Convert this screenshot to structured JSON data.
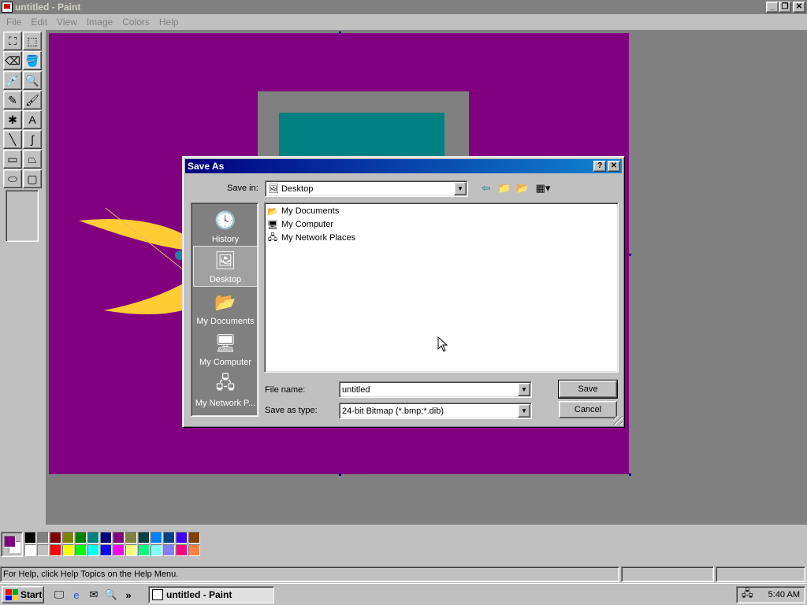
{
  "window": {
    "title": "untitled - Paint",
    "menus": [
      "File",
      "Edit",
      "View",
      "Image",
      "Colors",
      "Help"
    ]
  },
  "tools": [
    {
      "name": "free-select-icon",
      "glyph": "⛶"
    },
    {
      "name": "rect-select-icon",
      "glyph": "⬚"
    },
    {
      "name": "eraser-icon",
      "glyph": "⌫"
    },
    {
      "name": "fill-bucket-icon",
      "glyph": "🪣"
    },
    {
      "name": "color-picker-icon",
      "glyph": "💉"
    },
    {
      "name": "magnifier-icon",
      "glyph": "🔍"
    },
    {
      "name": "pencil-icon",
      "glyph": "✎"
    },
    {
      "name": "brush-icon",
      "glyph": "🖌"
    },
    {
      "name": "airbrush-icon",
      "glyph": "✱"
    },
    {
      "name": "text-icon",
      "glyph": "A"
    },
    {
      "name": "line-icon",
      "glyph": "╲"
    },
    {
      "name": "curve-icon",
      "glyph": "∫"
    },
    {
      "name": "rectangle-icon",
      "glyph": "▭"
    },
    {
      "name": "polygon-icon",
      "glyph": "⏢"
    },
    {
      "name": "ellipse-icon",
      "glyph": "⬭"
    },
    {
      "name": "rounded-rect-icon",
      "glyph": "▢"
    }
  ],
  "palette": {
    "foreground": "#800080",
    "background": "#ffffff",
    "top_row": [
      "#000000",
      "#808080",
      "#800000",
      "#808000",
      "#008000",
      "#008080",
      "#000080",
      "#800080",
      "#808040",
      "#004040",
      "#0080ff",
      "#004080",
      "#4000ff",
      "#804000"
    ],
    "bottom_row": [
      "#ffffff",
      "#c0c0c0",
      "#ff0000",
      "#ffff00",
      "#00ff00",
      "#00ffff",
      "#0000ff",
      "#ff00ff",
      "#ffff80",
      "#00ff80",
      "#80ffff",
      "#8080ff",
      "#ff0080",
      "#ff8040"
    ]
  },
  "status": {
    "help_text": "For Help, click Help Topics on the Help Menu."
  },
  "taskbar": {
    "start_label": "Start",
    "task_label": "untitled - Paint",
    "clock": "5:40 AM",
    "overflow": "»"
  },
  "dialog": {
    "title": "Save As",
    "help_btn": "?",
    "close_btn": "✕",
    "save_in_label": "Save in:",
    "save_in_value": "Desktop",
    "places": [
      {
        "label": "History",
        "glyph": "🕓"
      },
      {
        "label": "Desktop",
        "glyph": "🖼"
      },
      {
        "label": "My Documents",
        "glyph": "📂"
      },
      {
        "label": "My Computer",
        "glyph": "🖥"
      },
      {
        "label": "My Network P...",
        "glyph": "🖧"
      }
    ],
    "files": [
      {
        "label": "My Documents",
        "glyph": "📂"
      },
      {
        "label": "My Computer",
        "glyph": "🖥"
      },
      {
        "label": "My Network Places",
        "glyph": "🖧"
      }
    ],
    "file_name_label": "File name:",
    "file_name_value": "untitled",
    "save_type_label": "Save as type:",
    "save_type_value": "24-bit Bitmap (*.bmp;*.dib)",
    "save_button": "Save",
    "cancel_button": "Cancel"
  },
  "colors": {
    "canvas": "#800080",
    "gray_rect": "#808080",
    "teal_rect": "#008080",
    "yellow": "#ffcc33"
  }
}
